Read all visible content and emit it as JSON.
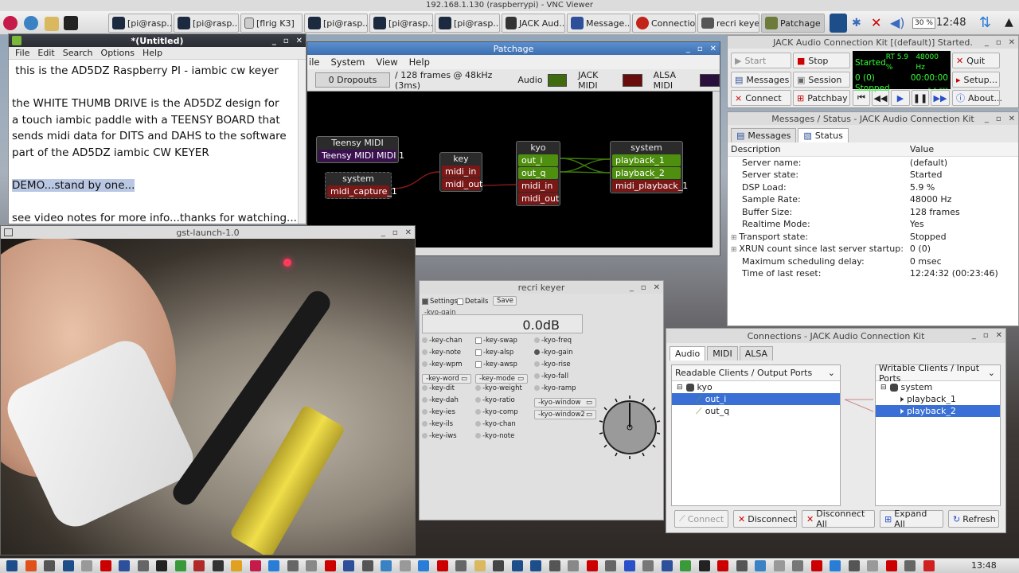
{
  "vnc_title": "192.168.1.130 (raspberrypi) - VNC Viewer",
  "taskbar": {
    "buttons": [
      "[pi@rasp...",
      "[pi@rasp...",
      "[flrig K3]",
      "[pi@rasp...",
      "[pi@rasp...",
      "[pi@rasp...",
      "JACK Aud...",
      "Message...",
      "Connectio...",
      "recri keyer",
      "Patchage"
    ],
    "cpu": "30 %",
    "time": "12:48"
  },
  "editor": {
    "title": "*(Untitled)",
    "menu": [
      "File",
      "Edit",
      "Search",
      "Options",
      "Help"
    ],
    "lines": [
      " this is the AD5DZ Raspberry PI - iambic cw keyer",
      "",
      "the WHITE THUMB DRIVE is the AD5DZ design for",
      "a touch iambic paddle with a TEENSY BOARD that",
      "sends midi data for DITS and DAHS to the software",
      "part of the AD5DZ iambic CW KEYER",
      "",
      "DEMO...stand by one...",
      "",
      "see video notes for more info...thanks for watching..."
    ]
  },
  "patchage": {
    "title": "Patchage",
    "menu": [
      "ile",
      "System",
      "View",
      "Help"
    ],
    "dropouts": "0 Dropouts",
    "frames": "/ 128 frames @ 48kHz (3ms)",
    "audio_label": "Audio",
    "jack_midi_label": "JACK MIDI",
    "alsa_midi_label": "ALSA MIDI",
    "nodes": {
      "teensy": {
        "name": "Teensy MIDI",
        "ports": [
          "Teensy MIDI MIDI 1"
        ]
      },
      "system_in": {
        "name": "system",
        "ports": [
          "midi_capture_1"
        ]
      },
      "key": {
        "name": "key",
        "ports": [
          "midi_in",
          "midi_out"
        ]
      },
      "kyo": {
        "name": "kyo",
        "ports": [
          "out_i",
          "out_q",
          "midi_in",
          "midi_out"
        ]
      },
      "system_out": {
        "name": "system",
        "ports": [
          "playback_1",
          "playback_2",
          "midi_playback_1"
        ]
      }
    }
  },
  "qjack": {
    "title": "JACK Audio Connection Kit [(default)] Started.",
    "start": "Start",
    "stop": "Stop",
    "quit": "Quit",
    "messages": "Messages",
    "session": "Session",
    "setup": "Setup...",
    "connect": "Connect",
    "patchbay": "Patchbay",
    "about": "About...",
    "lcd": {
      "state": "Started",
      "rt": "RT 5.9 %",
      "rate": "48000 Hz",
      "xruns": "0 (0)",
      "time": "00:00:00",
      "transport": "Stopped",
      "bbt": "-.-.---"
    }
  },
  "status": {
    "title": "Messages / Status - JACK Audio Connection Kit",
    "tabs": [
      "Messages",
      "Status"
    ],
    "headers": [
      "Description",
      "Value"
    ],
    "rows": [
      [
        "Server name:",
        "(default)"
      ],
      [
        "Server state:",
        "Started"
      ],
      [
        "DSP Load:",
        "5.9 %"
      ],
      [
        "Sample Rate:",
        "48000 Hz"
      ],
      [
        "Buffer Size:",
        "128 frames"
      ],
      [
        "Realtime Mode:",
        "Yes"
      ],
      [
        "Transport state:",
        "Stopped"
      ],
      [
        "XRUN count since last server startup:",
        "0 (0)"
      ],
      [
        "Maximum scheduling delay:",
        "0 msec"
      ],
      [
        "Time of last reset:",
        "12:24:32 (00:23:46)"
      ]
    ]
  },
  "recri": {
    "title": "recri keyer",
    "settings": "Settings",
    "details": "Details",
    "save": "Save",
    "gain_label": "-kyo-gain",
    "gain_value": "0.0dB",
    "col1": [
      "-key-chan",
      "-key-note",
      "-key-wpm",
      "-key-word",
      "-key-dit",
      "-key-dah",
      "-key-ies",
      "-key-ils",
      "-key-iws"
    ],
    "col2": [
      "-key-swap",
      "-key-alsp",
      "-key-awsp",
      "-key-mode",
      "-kyo-weight",
      "-kyo-ratio",
      "-kyo-comp",
      "-kyo-chan",
      "-kyo-note"
    ],
    "col3": [
      "-kyo-freq",
      "-kyo-gain",
      "-kyo-rise",
      "-kyo-fall",
      "-kyo-ramp",
      "-kyo-window",
      "-kyo-window2"
    ]
  },
  "connections": {
    "title": "Connections - JACK Audio Connection Kit",
    "tabs": [
      "Audio",
      "MIDI",
      "ALSA"
    ],
    "left_header": "Readable Clients / Output Ports",
    "right_header": "Writable Clients / Input Ports",
    "left_client": "kyo",
    "left_ports": [
      "out_i",
      "out_q"
    ],
    "right_client": "system",
    "right_ports": [
      "playback_1",
      "playback_2"
    ],
    "buttons": [
      "Connect",
      "Disconnect",
      "Disconnect All",
      "Expand All",
      "Refresh"
    ]
  },
  "gst": {
    "title": "gst-launch-1.0"
  },
  "bottombar": {
    "time": "13:48"
  }
}
